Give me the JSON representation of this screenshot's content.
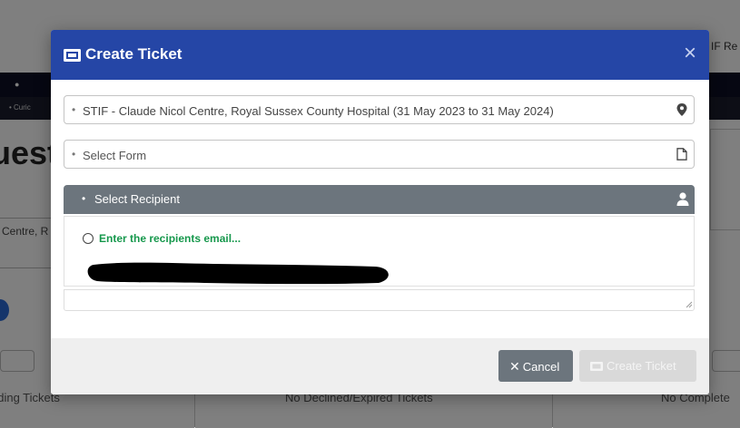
{
  "background": {
    "top_right_text": "IF Re",
    "nav_link": "Curic",
    "heading": "uest",
    "filter_text": "Centre, R",
    "cards": [
      "nding Tickets",
      "No Declined/Expired Tickets",
      "No Complete"
    ]
  },
  "modal": {
    "title": "Create Ticket",
    "title_icon": "ticket-icon",
    "close_label": "×",
    "location_field": {
      "value": "STIF - Claude Nicol Centre, Royal Sussex County Hospital (31 May 2023 to 31 May 2024)",
      "icon": "map-pin-icon"
    },
    "form_field": {
      "placeholder": "Select Form",
      "icon": "document-icon"
    },
    "recipient": {
      "label": "Select Recipient",
      "icon": "user-icon",
      "option_label": "Enter the recipients email..."
    },
    "footer": {
      "cancel_label": "Cancel",
      "create_label": "Create Ticket"
    }
  },
  "colors": {
    "header": "#2546a6",
    "recipient_bar": "#6c757d",
    "option_text": "#16984c",
    "cancel_button": "#6c757d",
    "create_button_disabled": "#d9d9d9"
  }
}
